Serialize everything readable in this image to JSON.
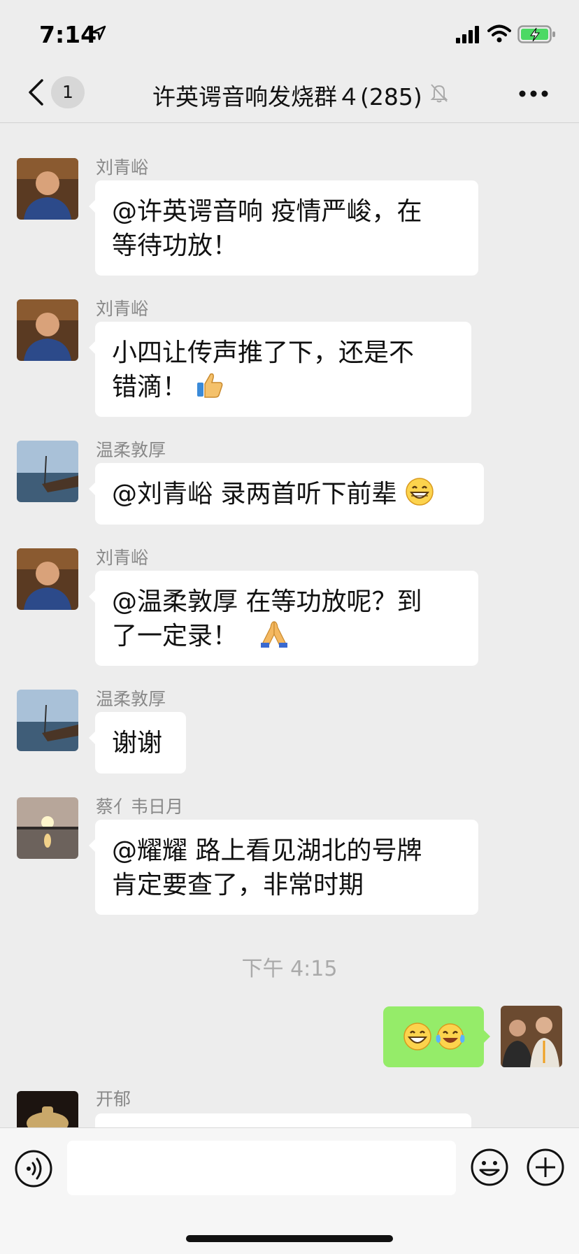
{
  "status_bar": {
    "time": "7:14",
    "icons": [
      "location-arrow-icon",
      "cellular-signal-icon",
      "wifi-icon",
      "battery-charging-icon"
    ]
  },
  "nav": {
    "back_icon": "chevron-left-icon",
    "unread_count": "1",
    "title": "许英谔音响发烧群４(285)",
    "mute_icon": "bell-slash-icon",
    "more_icon": "ellipsis-icon"
  },
  "messages": [
    {
      "sender": "刘青峪",
      "lines": [
        "@许英谔音响 疫情严峻，在",
        "等待功放！"
      ]
    },
    {
      "sender": "刘青峪",
      "lines": [
        "小四让传声推了下，还是不",
        "错滴！"
      ],
      "emoji": "thumbs-up-icon"
    },
    {
      "sender": "温柔敦厚",
      "lines": [
        "@刘青峪 录两首听下前辈"
      ],
      "emoji": "grinning-face-icon"
    },
    {
      "sender": "刘青峪",
      "lines": [
        "@温柔敦厚 在等功放呢？到",
        "了一定录！"
      ],
      "emoji": "folded-hands-icon"
    },
    {
      "sender": "温柔敦厚",
      "lines": [
        "谢谢"
      ]
    },
    {
      "sender": "蔡亻韦日月",
      "lines": [
        "@耀耀 路上看见湖北的号牌",
        "肯定要查了，非常时期"
      ]
    },
    {
      "sender": "开郁",
      "lines": []
    }
  ],
  "timestamp": "下午 4:15",
  "my_message": {
    "emojis": [
      "grinning-face-icon",
      "face-with-tears-of-joy-icon"
    ]
  },
  "input_bar": {
    "voice_icon": "voice-icon",
    "emoji_icon": "smiley-icon",
    "plus_icon": "plus-circle-icon"
  },
  "colors": {
    "background": "#ededed",
    "my_bubble": "#95ec69",
    "their_bubble": "#ffffff"
  }
}
